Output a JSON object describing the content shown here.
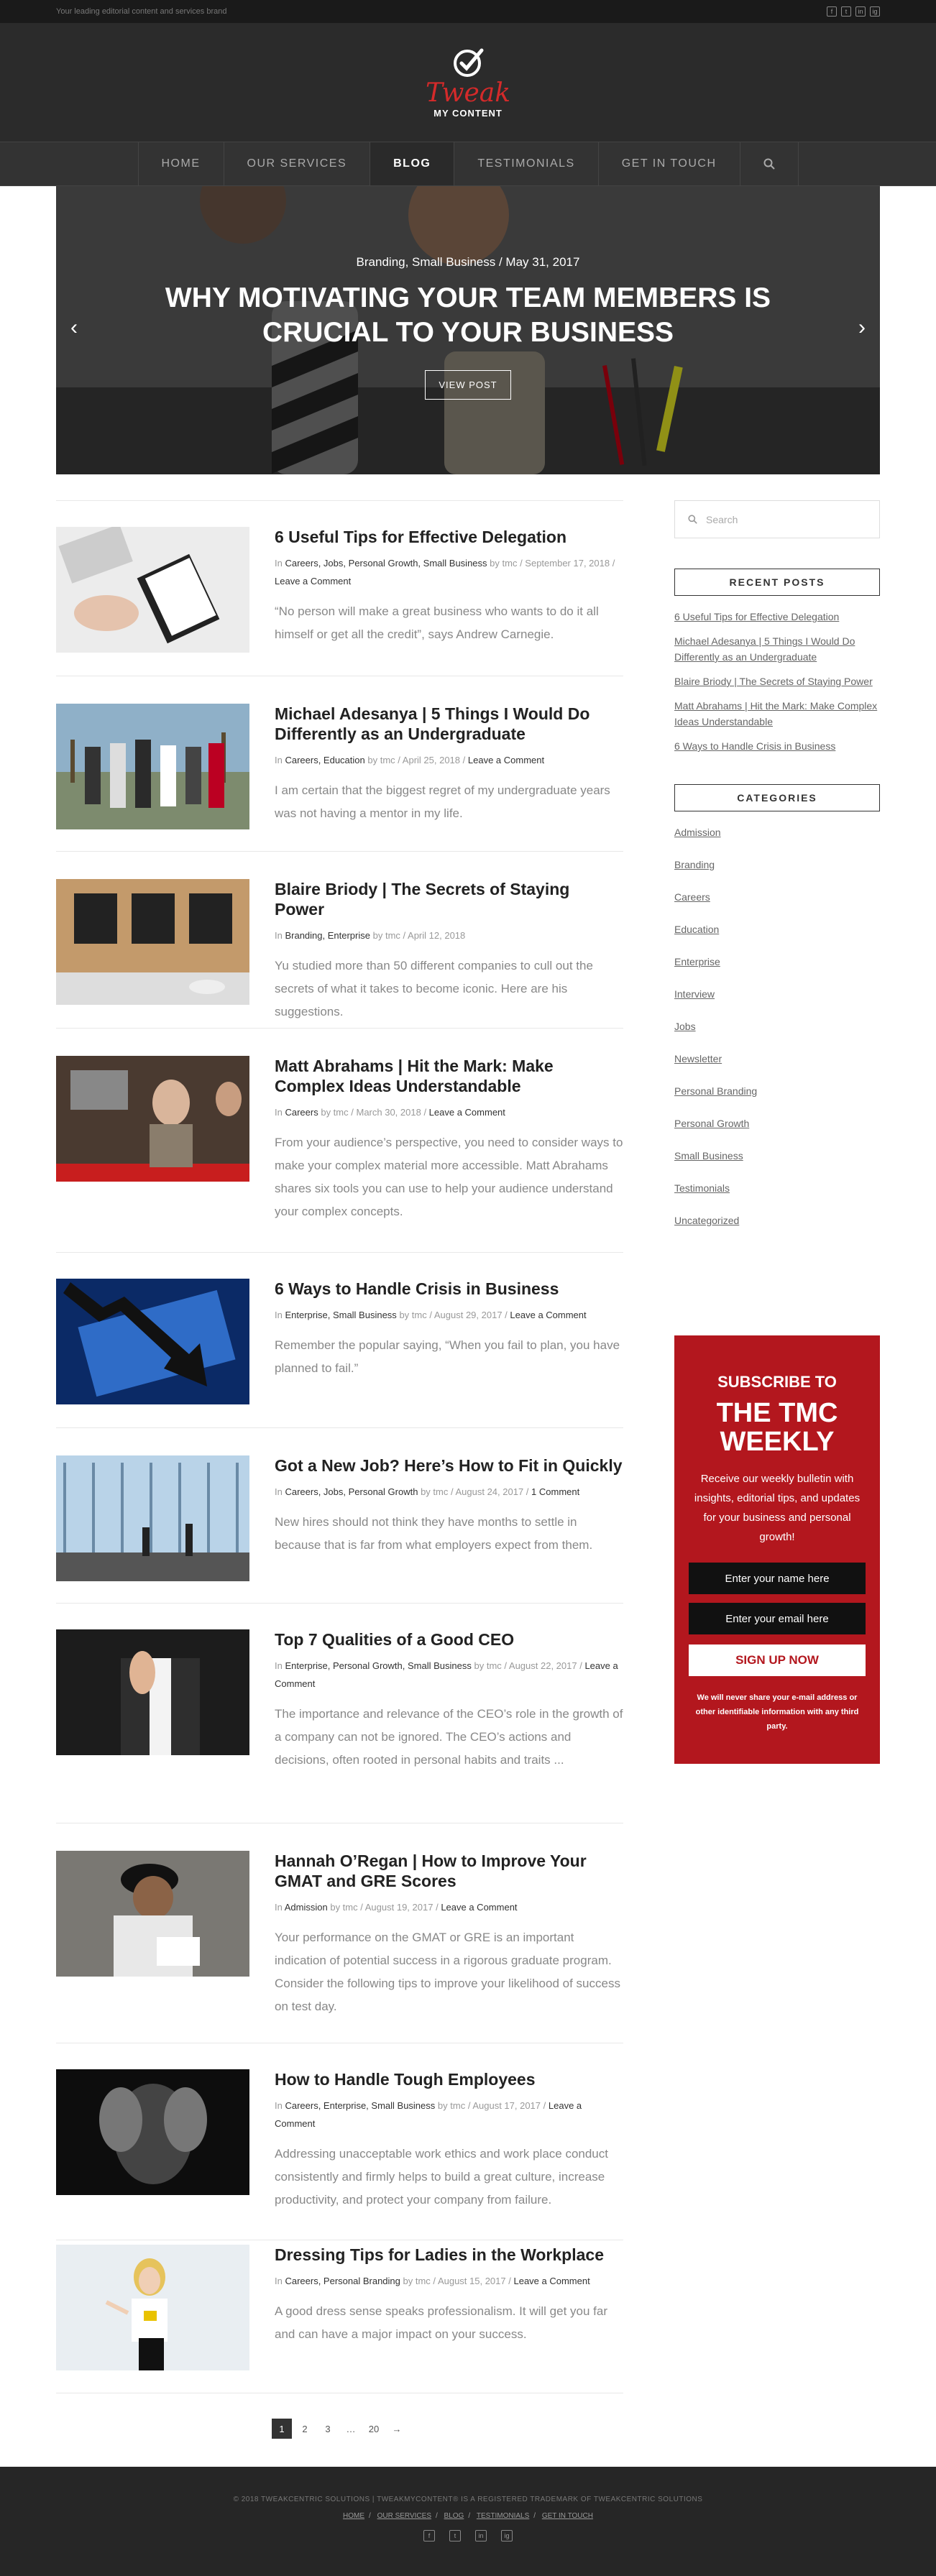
{
  "topbar": {
    "tagline": "Your leading editorial content and services brand",
    "social": [
      "f",
      "t",
      "in",
      "ig"
    ]
  },
  "logo": {
    "word": "Tweak",
    "sub": "MY CONTENT"
  },
  "nav": {
    "items": [
      "HOME",
      "OUR SERVICES",
      "BLOG",
      "TESTIMONIALS",
      "GET IN TOUCH"
    ],
    "active": "BLOG",
    "search_icon": "search-icon"
  },
  "hero": {
    "meta": "Branding, Small Business / May 31, 2017",
    "title": "WHY MOTIVATING YOUR TEAM MEMBERS IS CRUCIAL TO YOUR BUSINESS",
    "button": "VIEW POST",
    "prev": "‹",
    "next": "›"
  },
  "posts": [
    {
      "title": "6 Useful Tips for Effective Delegation",
      "meta_in": "In",
      "cats": "Careers, Jobs, Personal Growth, Small Business",
      "by": "by tmc",
      "date": "September 17, 2018",
      "comment": "Leave a Comment",
      "excerpt": "“No person will make a great business who wants to do it all himself or get all the credit”, says Andrew Carnegie."
    },
    {
      "title": "Michael Adesanya | 5 Things I Would Do Differently as an Undergraduate",
      "meta_in": "In",
      "cats": "Careers, Education",
      "by": "by tmc",
      "date": "April 25, 2018",
      "comment": "Leave a Comment",
      "excerpt": "I am certain that the biggest regret of my undergraduate years was not having a mentor in my life."
    },
    {
      "title": "Blaire Briody | The Secrets of Staying Power",
      "meta_in": "In",
      "cats": "Branding, Enterprise",
      "by": "by tmc",
      "date": "April 12, 2018",
      "comment": "",
      "excerpt": "Yu studied more than 50 different companies to cull out the secrets of what it takes to become iconic. Here are his suggestions."
    },
    {
      "title": "Matt Abrahams | Hit the Mark: Make Complex Ideas Understandable",
      "meta_in": "In",
      "cats": "Careers",
      "by": "by tmc",
      "date": "March 30, 2018",
      "comment": "Leave a Comment",
      "excerpt": "From your audience’s perspective, you need to consider ways to make your complex material more accessible. Matt Abrahams shares six tools you can use to help your audience understand your complex concepts."
    },
    {
      "title": "6 Ways to Handle Crisis in Business",
      "meta_in": "In",
      "cats": "Enterprise, Small Business",
      "by": "by tmc",
      "date": "August 29, 2017",
      "comment": "Leave a Comment",
      "excerpt": "Remember the popular saying, “When you fail to plan, you have planned to fail.”"
    },
    {
      "title": "Got a New Job? Here’s How to Fit in Quickly",
      "meta_in": "In",
      "cats": "Careers, Jobs, Personal Growth",
      "by": "by tmc",
      "date": "August 24, 2017",
      "comment": "1 Comment",
      "excerpt": "New hires should not think they have months to settle in because that is far from what employers expect from them."
    },
    {
      "title": "Top 7 Qualities of a Good CEO",
      "meta_in": "In",
      "cats": "Enterprise, Personal Growth, Small Business",
      "by": "by tmc",
      "date": "August 22, 2017",
      "comment": "Leave a Comment",
      "excerpt": "The importance and relevance of the CEO’s role in the growth of a company can not be ignored. The CEO’s actions and decisions, often rooted in personal habits and traits ..."
    },
    {
      "title": "Hannah O’Regan | How to Improve Your GMAT and GRE Scores",
      "meta_in": "In",
      "cats": "Admission",
      "by": "by tmc",
      "date": "August 19, 2017",
      "comment": "Leave a Comment",
      "excerpt": "Your performance on the GMAT or GRE is an important indication of potential success in a rigorous graduate program. Consider the following tips to improve your likelihood of success on test day."
    },
    {
      "title": "How to Handle Tough Employees",
      "meta_in": "In",
      "cats": "Careers, Enterprise, Small Business",
      "by": "by tmc",
      "date": "August 17, 2017",
      "comment": "Leave a Comment",
      "excerpt": "Addressing unacceptable work ethics and work place conduct consistently and firmly helps to build a great culture, increase productivity, and protect your company from failure."
    },
    {
      "title": "Dressing Tips for Ladies in the Workplace",
      "meta_in": "In",
      "cats": "Careers, Personal Branding",
      "by": "by tmc",
      "date": "August 15, 2017",
      "comment": "Leave a Comment",
      "excerpt": "A good dress sense speaks professionalism. It will get you far and can have a major impact on your success."
    }
  ],
  "pagination": {
    "pages": [
      "1",
      "2",
      "3",
      "…",
      "20",
      "→"
    ]
  },
  "sidebar": {
    "search_placeholder": "Search",
    "recent_title": "RECENT POSTS",
    "recent": [
      "6 Useful Tips for Effective Delegation",
      "Michael Adesanya | 5 Things I Would Do Differently as an Undergraduate",
      "Blaire Briody | The Secrets of Staying Power",
      "Matt Abrahams | Hit the Mark: Make Complex Ideas Understandable",
      "6 Ways to Handle Crisis in Business"
    ],
    "categories_title": "CATEGORIES",
    "categories": [
      "Admission",
      "Branding",
      "Careers",
      "Education",
      "Enterprise",
      "Interview",
      "Jobs",
      "Newsletter",
      "Personal Branding",
      "Personal Growth",
      "Small Business",
      "Testimonials",
      "Uncategorized"
    ]
  },
  "subscribe": {
    "heading": "SUBSCRIBE TO",
    "big": "THE TMC WEEKLY",
    "text": "Receive our weekly bulletin with insights, editorial tips, and updates for your business and personal growth!",
    "name_placeholder": "Enter your name here",
    "email_placeholder": "Enter your email here",
    "button": "SIGN UP NOW",
    "small": "We will never share your e-mail address or other identifiable information with any third party."
  },
  "footer": {
    "copyright": "© 2018 TWEAKCENTRIC SOLUTIONS | TWEAKMYCONTENT® IS A REGISTERED TRADEMARK OF TWEAKCENTRIC SOLUTIONS",
    "links": [
      "HOME",
      "OUR SERVICES",
      "BLOG",
      "TESTIMONIALS",
      "GET IN TOUCH"
    ],
    "social": [
      "f",
      "t",
      "in",
      "ig"
    ]
  },
  "colors": {
    "brand_red": "#b3171e",
    "logo_red": "#d42a2a",
    "dark": "#2b2b2b",
    "footer": "#262626"
  }
}
